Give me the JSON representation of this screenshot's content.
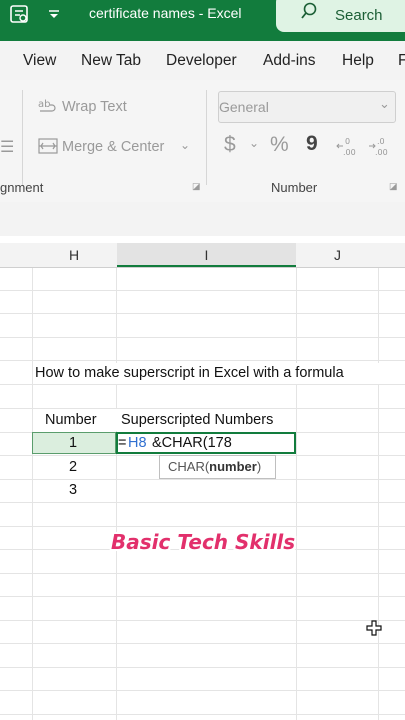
{
  "window": {
    "title": "certificate names  -  Excel",
    "search_label": "Search"
  },
  "menu": {
    "items": [
      "View",
      "New Tab",
      "Developer",
      "Add-ins",
      "Help",
      "F"
    ]
  },
  "ribbon": {
    "wrap_text": "Wrap Text",
    "merge_center": "Merge & Center",
    "alignment_group": "gnment",
    "number_format_value": "General",
    "currency_symbol": "$",
    "percent_symbol": "%",
    "comma_symbol": "9",
    "number_group": "Number"
  },
  "sheet": {
    "columns": [
      "H",
      "I",
      "J"
    ],
    "title_text": "How to make superscript in Excel with a formula",
    "header_number": "Number",
    "header_superscripted": "Superscripted Numbers",
    "numbers": [
      "1",
      "2",
      "3"
    ],
    "formula_ref": "H8",
    "formula_prefix": "=",
    "formula_rest": "&CHAR(178",
    "tooltip_func": "CHAR(",
    "tooltip_arg": "number",
    "tooltip_close": ")"
  },
  "overlay": {
    "brand_text": "Basic Tech Skills"
  },
  "colors": {
    "excel_green": "#127c3d",
    "formula_ref_blue": "#2f6fd0",
    "brand_pink": "#e2306c"
  }
}
